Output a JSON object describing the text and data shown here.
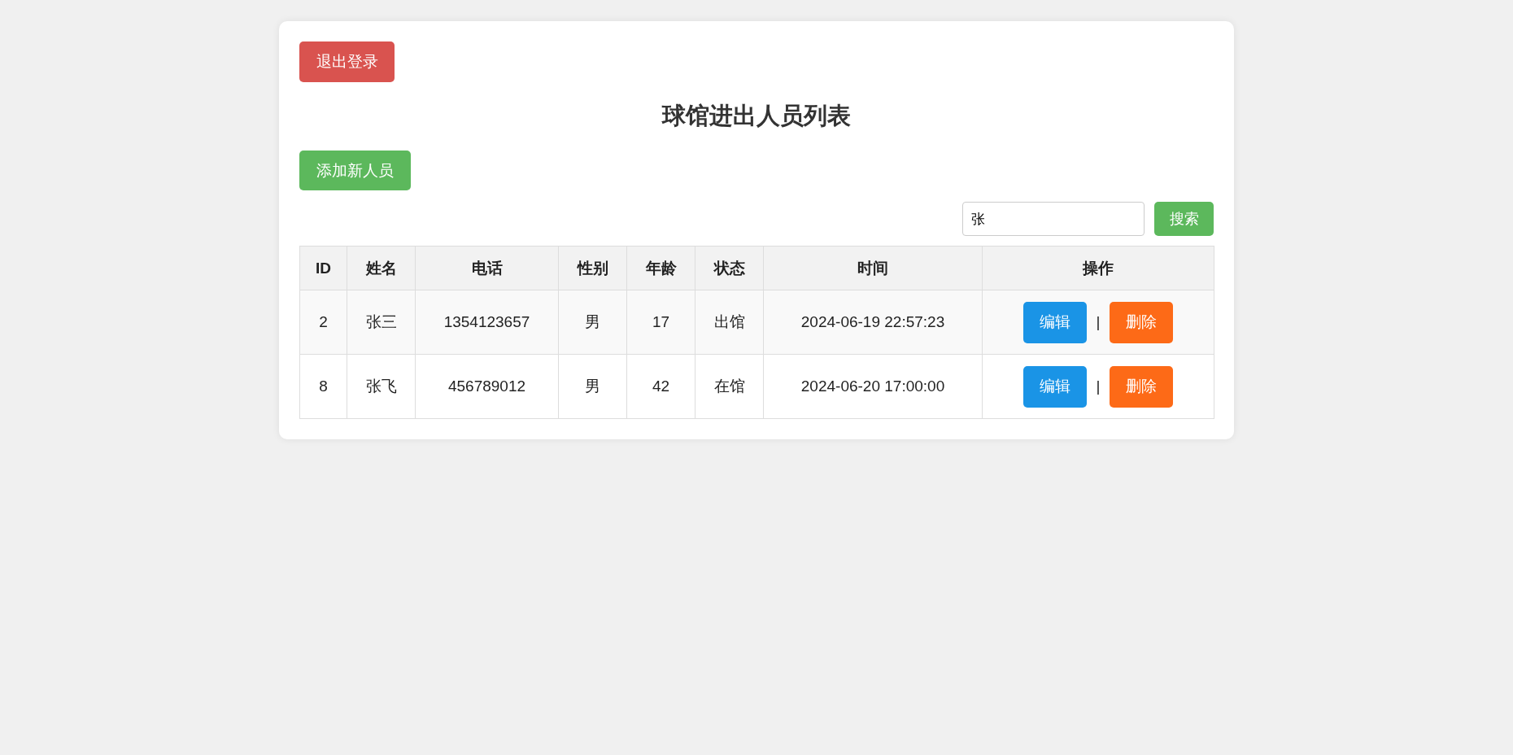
{
  "logout_button": "退出登录",
  "title": "球馆进出人员列表",
  "add_button": "添加新人员",
  "search": {
    "value": "张",
    "button": "搜索"
  },
  "table": {
    "columns": [
      "ID",
      "姓名",
      "电话",
      "性别",
      "年龄",
      "状态",
      "时间",
      "操作"
    ],
    "rows": [
      {
        "cells": [
          "2",
          "张三",
          "1354123657",
          "男",
          "17",
          "出馆",
          "2024-06-19 22:57:23"
        ],
        "actions": [
          {
            "kind": "edit",
            "label": "编辑"
          },
          {
            "kind": "delete",
            "label": "删除"
          }
        ],
        "separator": "|"
      },
      {
        "cells": [
          "8",
          "张飞",
          "456789012",
          "男",
          "42",
          "在馆",
          "2024-06-20 17:00:00"
        ],
        "actions": [
          {
            "kind": "edit",
            "label": "编辑"
          },
          {
            "kind": "delete",
            "label": "删除"
          }
        ],
        "separator": "|"
      }
    ]
  }
}
